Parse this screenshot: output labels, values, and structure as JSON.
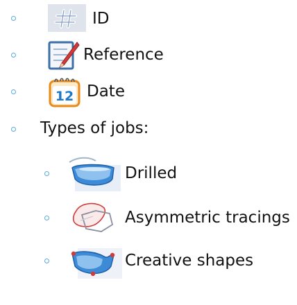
{
  "list": {
    "items": [
      {
        "icon": "hash-icon",
        "label": "ID"
      },
      {
        "icon": "reference-notepad-icon",
        "label": "Reference"
      },
      {
        "icon": "calendar-date-icon",
        "label": "Date"
      },
      {
        "label": "Types of jobs:"
      }
    ],
    "sublist": [
      {
        "icon": "drilled-lens-icon",
        "label": "Drilled"
      },
      {
        "icon": "asymmetric-tracing-icon",
        "label": "Asymmetric tracings"
      },
      {
        "icon": "creative-shape-icon",
        "label": "Creative shapes"
      }
    ]
  },
  "colors": {
    "bullet": "#58a8e0",
    "text": "#111111",
    "icon_tile": "#dfe4ec",
    "accent_blue": "#1e78c8",
    "accent_red": "#d23a3a",
    "accent_orange": "#e88a1a"
  }
}
